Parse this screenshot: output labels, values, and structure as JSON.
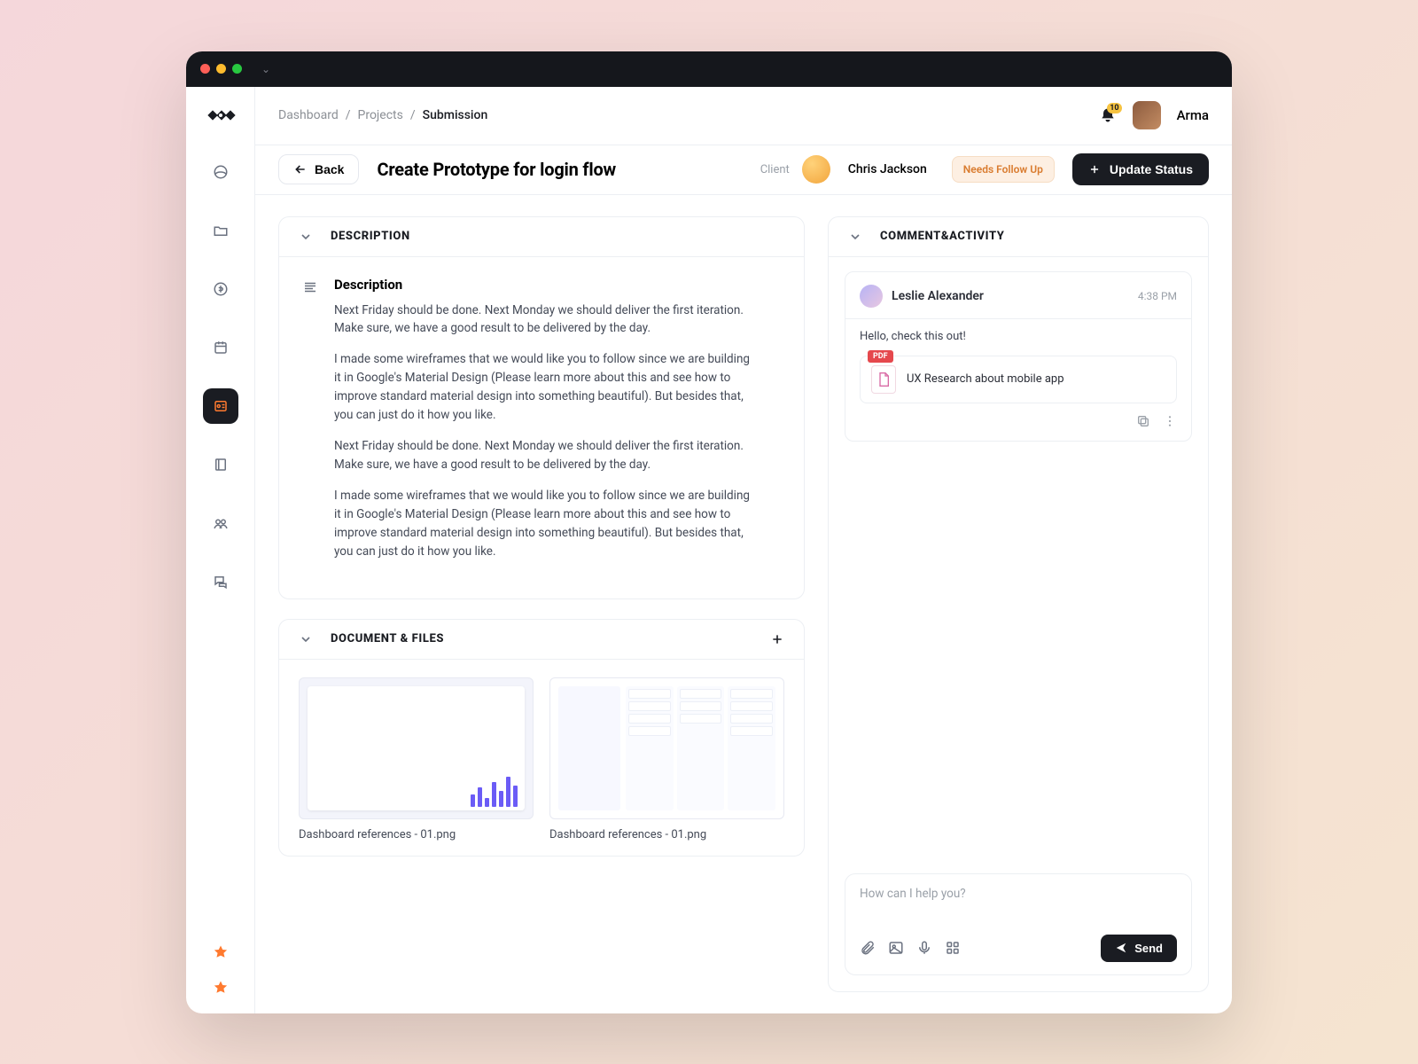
{
  "user": {
    "name": "Arma",
    "notifications_badge": "10"
  },
  "breadcrumbs": {
    "a": "Dashboard",
    "b": "Projects",
    "c": "Submission"
  },
  "header": {
    "back": "Back",
    "title": "Create Prototype for login flow",
    "client_label": "Client",
    "client_name": "Chris Jackson",
    "status_pill": "Needs Follow Up",
    "update_btn": "Update Status"
  },
  "description": {
    "panel_title": "DESCRIPTION",
    "heading": "Description",
    "p1": "Next Friday should be done. Next Monday we should deliver the first iteration. Make sure, we have a good result to be delivered by the day.",
    "p2": "I made some wireframes that we would like you to follow since we are building it in Google's Material Design (Please learn more about this and see how to improve standard material design into something beautiful). But besides that, you can just do it how you like.",
    "p3": "Next Friday should be done. Next Monday we should deliver the first iteration. Make sure, we have a good result to be delivered by the day.",
    "p4": "I made some wireframes that we would like you to follow since we are building it in Google's Material Design (Please learn more about this and see how to improve standard material design into something beautiful). But besides that, you can just do it how you like."
  },
  "files": {
    "panel_title": "DOCUMENT & FILES",
    "items": [
      {
        "name": "Dashboard references - 01.png"
      },
      {
        "name": "Dashboard references - 01.png"
      }
    ]
  },
  "activity": {
    "panel_title": "COMMENT&ACTIVITY",
    "comment": {
      "author": "Leslie Alexander",
      "time": "4:38 PM",
      "message": "Hello, check this out!",
      "attachment_badge": "PDF",
      "attachment_name": "UX Research about mobile app"
    },
    "composer_placeholder": "How can I help you?",
    "send": "Send"
  }
}
